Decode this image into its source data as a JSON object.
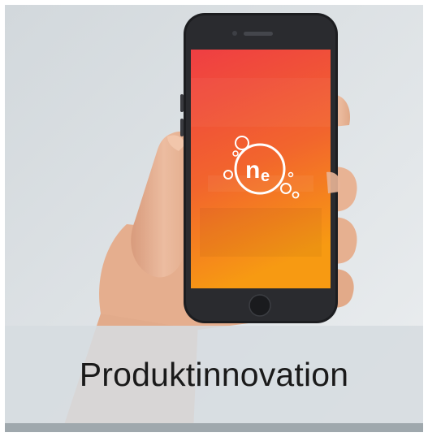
{
  "tile": {
    "caption": "Produktinnovation"
  },
  "phone": {
    "app_logo_text": "ne",
    "screen_gradient": [
      "#f0413f",
      "#f26a2c",
      "#f79a12"
    ],
    "body_color": "#1c1d20"
  },
  "colors": {
    "background": "#e3e7ea",
    "caption_band": "#d6dce0",
    "caption_text": "#1a1a1a",
    "skin": "#e7b596"
  },
  "icons": [
    "phone-icon",
    "app-logo-icon",
    "bubble-icon"
  ]
}
